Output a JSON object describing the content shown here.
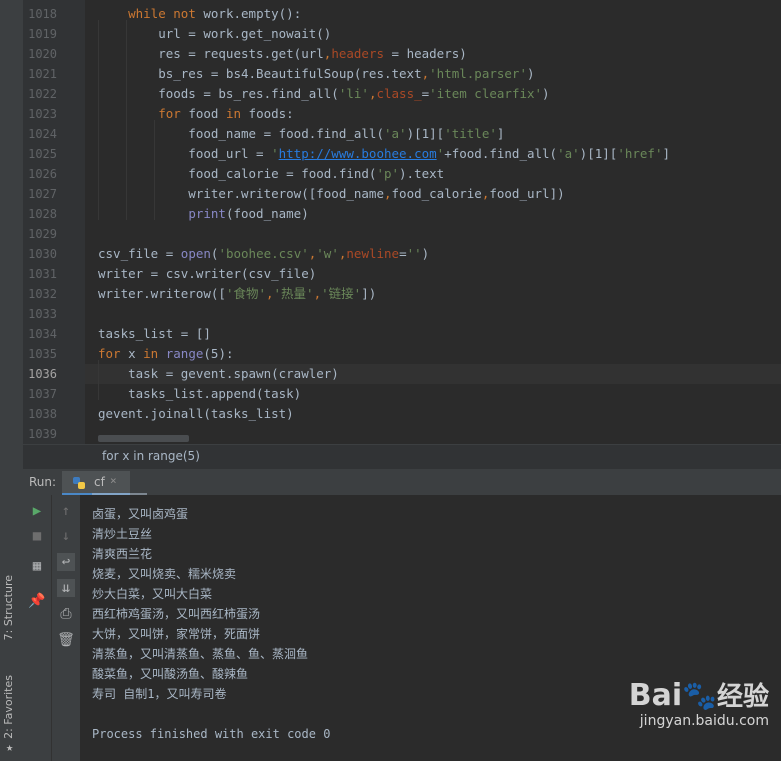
{
  "sidebar": {
    "structure_label": "7: Structure",
    "favorites_label": "2: Favorites"
  },
  "editor": {
    "lines": [
      {
        "n": "1018",
        "t": "    while not work.empty():"
      },
      {
        "n": "1019",
        "t": "        url = work.get_nowait()"
      },
      {
        "n": "1020",
        "t": "        res = requests.get(url,headers = headers)"
      },
      {
        "n": "1021",
        "t": "        bs_res = bs4.BeautifulSoup(res.text,'html.parser')"
      },
      {
        "n": "1022",
        "t": "        foods = bs_res.find_all('li',class_='item clearfix')"
      },
      {
        "n": "1023",
        "t": "        for food in foods:"
      },
      {
        "n": "1024",
        "t": "            food_name = food.find_all('a')[1]['title']"
      },
      {
        "n": "1025",
        "t": "            food_url = 'http://www.boohee.com'+food.find_all('a')[1]['href']"
      },
      {
        "n": "1026",
        "t": "            food_calorie = food.find('p').text"
      },
      {
        "n": "1027",
        "t": "            writer.writerow([food_name,food_calorie,food_url])"
      },
      {
        "n": "1028",
        "t": "            print(food_name)"
      },
      {
        "n": "1029",
        "t": ""
      },
      {
        "n": "1030",
        "t": "csv_file = open('boohee.csv','w',newline='')"
      },
      {
        "n": "1031",
        "t": "writer = csv.writer(csv_file)"
      },
      {
        "n": "1032",
        "t": "writer.writerow(['食物','热量','链接'])"
      },
      {
        "n": "1033",
        "t": ""
      },
      {
        "n": "1034",
        "t": "tasks_list = []"
      },
      {
        "n": "1035",
        "t": "for x in range(5):"
      },
      {
        "n": "1036",
        "t": "    task = gevent.spawn(crawler)"
      },
      {
        "n": "1037",
        "t": "    tasks_list.append(task)"
      },
      {
        "n": "1038",
        "t": "gevent.joinall(tasks_list)"
      },
      {
        "n": "1039",
        "t": ""
      }
    ],
    "breadcrumb": "for x in range(5)"
  },
  "run_panel": {
    "label": "Run:",
    "tab_name": "cf",
    "tab_close": "×",
    "output": [
      "卤蛋，又叫卤鸡蛋",
      "清炒土豆丝",
      "清爽西兰花",
      "烧麦，又叫烧卖、糯米烧卖",
      "炒大白菜，又叫大白菜",
      "西红柿鸡蛋汤，又叫西红柿蛋汤",
      "大饼，又叫饼，家常饼，死面饼",
      "清蒸鱼，又叫清蒸鱼、蒸鱼、鱼、蒸洄鱼",
      "酸菜鱼，又叫酸汤鱼、酸辣鱼",
      "寿司 自制1，又叫寿司卷",
      "",
      "Process finished with exit code 0"
    ]
  },
  "watermark": {
    "brand": "Bai",
    "brand2": "经验",
    "url": "jingyan.baidu.com"
  }
}
